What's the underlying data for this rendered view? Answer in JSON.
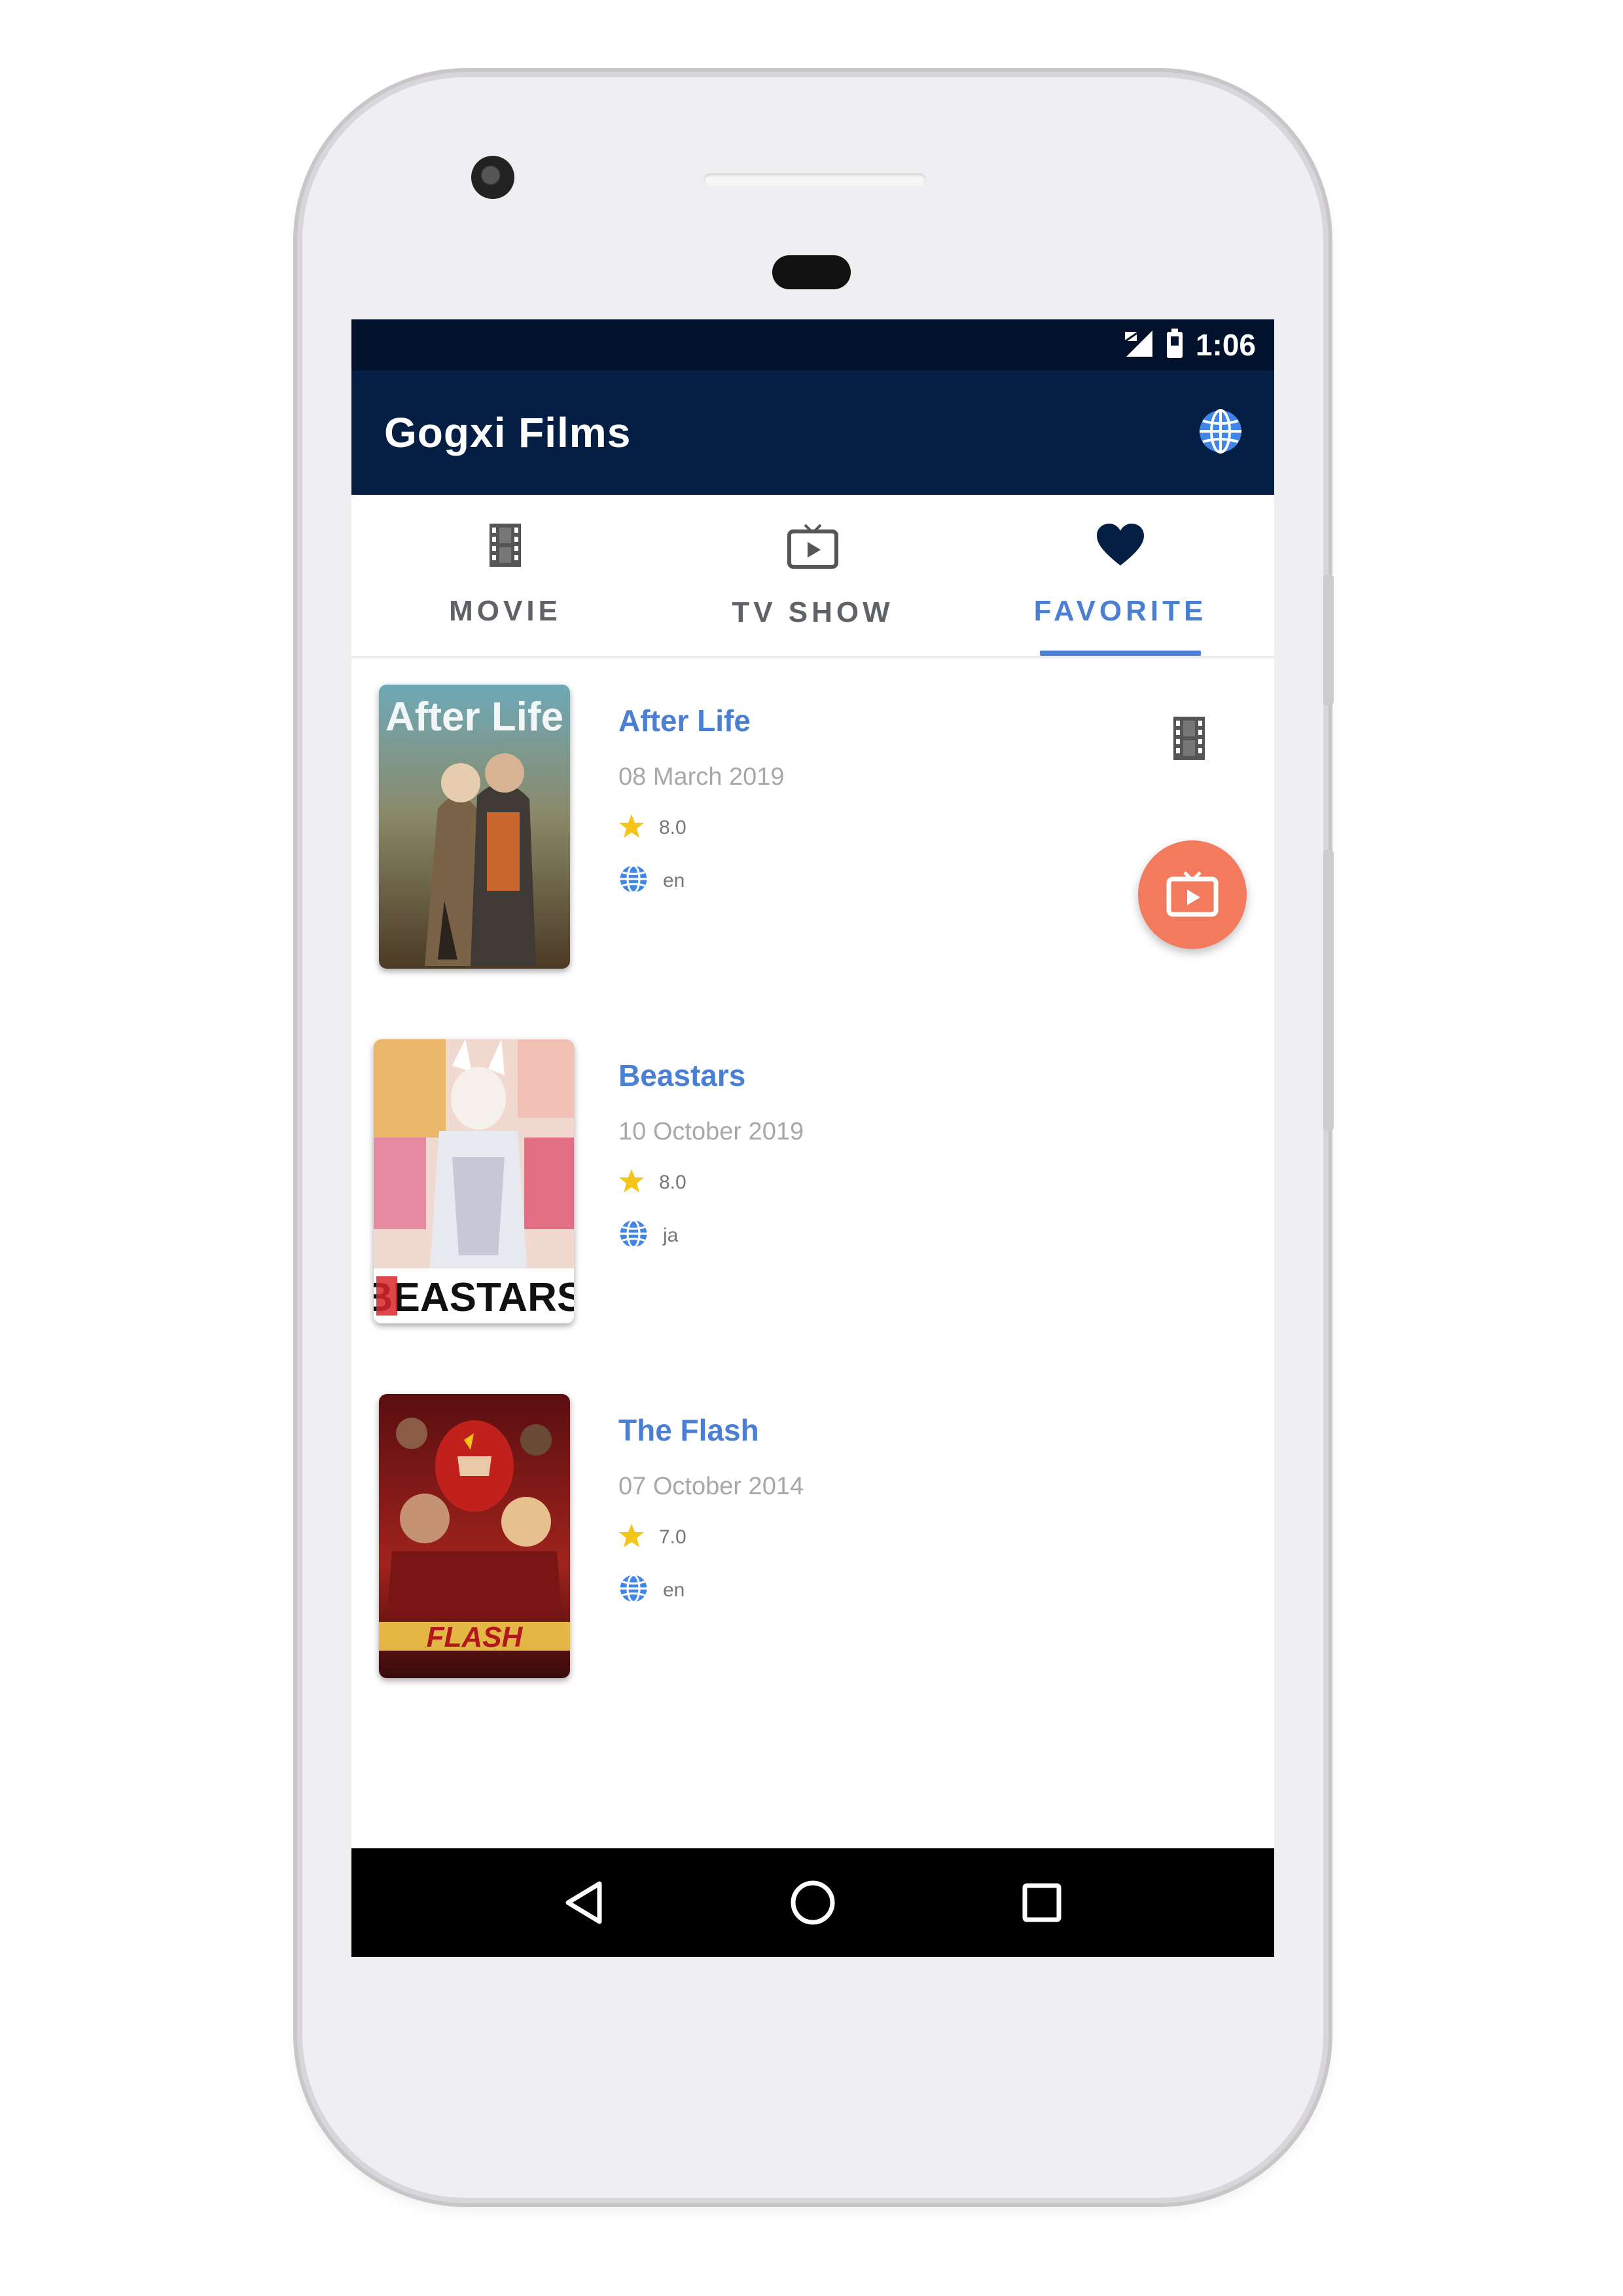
{
  "status_bar": {
    "time": "1:06"
  },
  "app_bar": {
    "title": "Gogxi Films",
    "language_icon": "globe-icon"
  },
  "tabs": [
    {
      "label": "MOVIE",
      "icon": "film-icon",
      "active": false
    },
    {
      "label": "TV SHOW",
      "icon": "tv-icon",
      "active": false
    },
    {
      "label": "FAVORITE",
      "icon": "heart-icon",
      "active": true
    }
  ],
  "favorites": [
    {
      "title": "After Life",
      "date": "08 March 2019",
      "rating": "8.0",
      "language": "en",
      "poster_text": "After Life"
    },
    {
      "title": "Beastars",
      "date": "10 October 2019",
      "rating": "8.0",
      "language": "ja",
      "poster_text": "BEASTARS"
    },
    {
      "title": "The Flash",
      "date": "07 October 2014",
      "rating": "7.0",
      "language": "en",
      "poster_text": "FLASH"
    }
  ],
  "fab": {
    "icon": "tv-icon"
  },
  "nav": {
    "back": "back-icon",
    "home": "home-icon",
    "recents": "recents-icon"
  },
  "colors": {
    "primary": "#051e44",
    "status": "#02122c",
    "accent": "#4a7fd4",
    "fab": "#f47a5e"
  }
}
